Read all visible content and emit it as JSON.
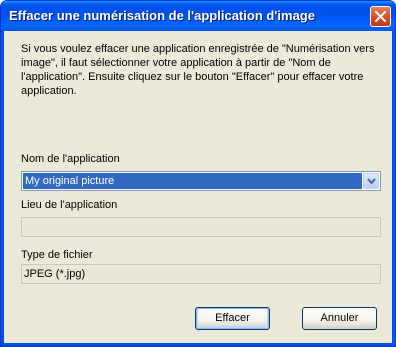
{
  "window": {
    "title": "Effacer une numérisation de l'application d'image"
  },
  "description": "Si vous voulez effacer une application enregistrée de \"Numérisation vers image\", il faut sélectionner votre application à partir de \"Nom de l'application\". Ensuite cliquez sur le bouton \"Effacer\" pour effacer votre application.",
  "app_name": {
    "label": "Nom de l'application",
    "selected": "My original picture"
  },
  "app_location": {
    "label": "Lieu de l'application",
    "value": ""
  },
  "file_type": {
    "label": "Type de fichier",
    "value": "JPEG (*.jpg)"
  },
  "buttons": {
    "delete": "Effacer",
    "cancel": "Annuler"
  },
  "colors": {
    "titlebar": "#0055e5",
    "selection": "#316ac5",
    "dialog_bg": "#ece9d8"
  },
  "icons": {
    "close": "close-icon",
    "dropdown": "chevron-down-icon"
  }
}
